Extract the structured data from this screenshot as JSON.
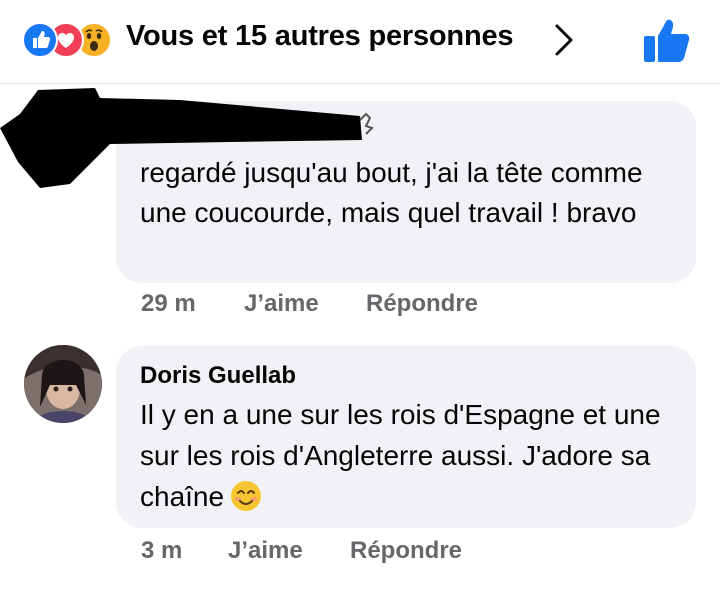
{
  "header": {
    "reactions": [
      "like-icon",
      "love-icon",
      "wow-icon"
    ],
    "summary": "Vous et 15 autres personnes",
    "like_button": "thumbs-up-icon"
  },
  "comments": [
    {
      "author": "",
      "author_redacted": true,
      "text": "regardé jusqu'au bout, j'ai la tête comme une coucourde, mais quel travail ! bravo",
      "time": "29 m",
      "like_label": "J’aime",
      "reply_label": "Répondre"
    },
    {
      "author": "Doris Guellab",
      "text": "Il y en a une sur les rois d'Espagne et une sur les rois d'Angleterre aussi. J'adore sa chaîne",
      "emoji": "smiling-face-icon",
      "time": "3 m",
      "like_label": "J’aime",
      "reply_label": "Répondre"
    }
  ],
  "colors": {
    "accent": "#1877f2",
    "bubble": "#f0f2f5",
    "meta_text": "#65676b",
    "love": "#f33e58",
    "wow": "#f7b125"
  }
}
